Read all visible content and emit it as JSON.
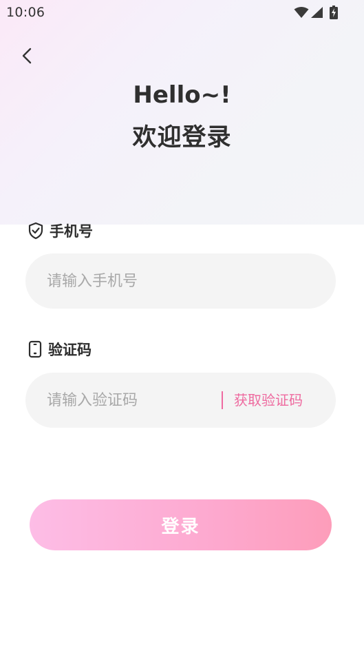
{
  "status_bar": {
    "time": "10:06",
    "icons": [
      "wifi-icon",
      "cell-signal-icon",
      "battery-charging-icon"
    ]
  },
  "nav": {
    "back_icon": "chevron-left-icon"
  },
  "header": {
    "greeting": "Hello~!",
    "welcome": "欢迎登录"
  },
  "phone_field": {
    "label": "手机号",
    "icon": "shield-check-icon",
    "placeholder": "请输入手机号",
    "value": ""
  },
  "code_field": {
    "label": "验证码",
    "icon": "phone-device-icon",
    "placeholder": "请输入验证码",
    "value": "",
    "get_code_label": "获取验证码"
  },
  "login": {
    "label": "登录"
  },
  "colors": {
    "accent": "#ee6a9f",
    "button_gradient_start": "#fdbde6",
    "button_gradient_end": "#fd9dba",
    "input_bg": "#f4f4f4"
  }
}
